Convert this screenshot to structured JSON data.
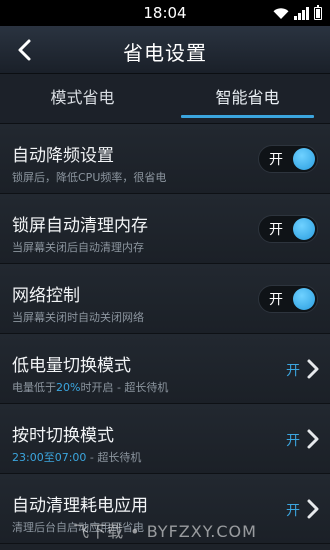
{
  "status_bar": {
    "time": "18:04"
  },
  "header": {
    "title": "省电设置",
    "back_icon": "back-arrow-icon"
  },
  "tabs": [
    {
      "label": "模式省电",
      "selected": false
    },
    {
      "label": "智能省电",
      "selected": true
    }
  ],
  "settings": [
    {
      "title": "自动降频设置",
      "description": "锁屏后，降低CPU频率，很省电",
      "control": "toggle",
      "state": "开"
    },
    {
      "title": "锁屏自动清理内存",
      "description": "当屏幕关闭后自动清理内存",
      "control": "toggle",
      "state": "开"
    },
    {
      "title": "网络控制",
      "description": "当屏幕关闭时自动关闭网络",
      "control": "toggle",
      "state": "开"
    },
    {
      "title": "低电量切换模式",
      "description_prefix": "电量低于",
      "description_highlight": "20%",
      "description_suffix": "时开启 - 超长待机",
      "control": "chevron",
      "state": "开"
    },
    {
      "title": "按时切换模式",
      "description_highlight": "23:00至07:00",
      "description_suffix": " - 超长待机",
      "control": "chevron",
      "state": "开"
    },
    {
      "title": "自动清理耗电应用",
      "description": "清理后台自启动应用可省电",
      "control": "chevron",
      "state": "开"
    }
  ],
  "watermark": "飞下载 • BYFZXY.COM",
  "colors": {
    "accent": "#3ba5de",
    "background": "#1d2229"
  }
}
